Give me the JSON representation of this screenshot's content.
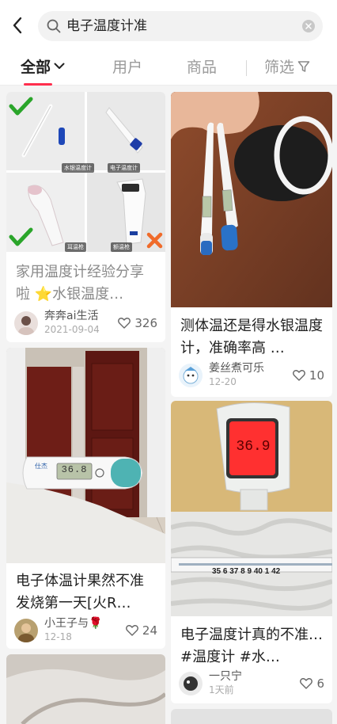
{
  "search": {
    "query": "电子温度计准"
  },
  "tabs": {
    "all": "全部",
    "users": "用户",
    "goods": "商品",
    "filter": "筛选"
  },
  "cards": [
    {
      "title": "家用温度计经验分享啦 ⭐水银温度…",
      "author": "奔奔ai生活",
      "date": "2021-09-04",
      "likes": "326",
      "image_labels": [
        "水银温度计",
        "电子温度计",
        "耳温枪",
        "额温枪"
      ]
    },
    {
      "title": "测体温还是得水银温度计，准确率高 …",
      "author": "姜丝煮可乐",
      "date": "12-20",
      "likes": "10"
    },
    {
      "title": "电子体温计果然不准 发烧第一天[火R…",
      "author": "小王子与🌹",
      "date": "12-18",
      "likes": "24",
      "device_display": "36.8"
    },
    {
      "title": "电子温度计真的不准…#温度计 #水…",
      "author": "一只宁",
      "date": "1天前",
      "likes": "6",
      "device_display": "36.9",
      "ruler_text": "35 6 37 8 9 40 1 42"
    }
  ]
}
